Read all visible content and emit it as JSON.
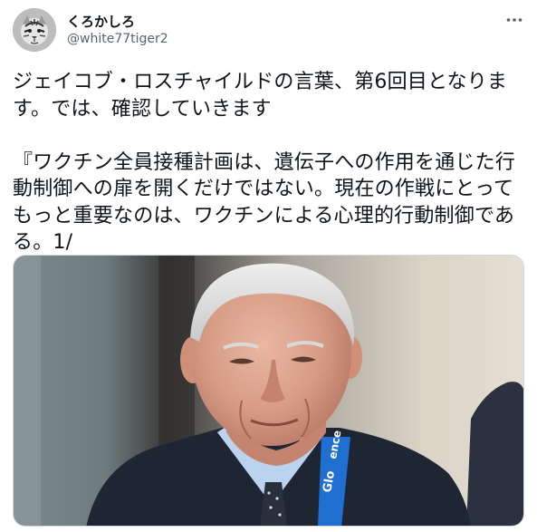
{
  "author": {
    "display_name": "くろかしろ",
    "handle": "@white77tiger2",
    "avatar_icon": "tiger-avatar-icon"
  },
  "menu": {
    "icon": "more-horizontal-icon"
  },
  "tweet": {
    "text": "ジェイコブ・ロスチャイルドの言葉、第6回目となります。では、確認していきます\n\n『ワクチン全員接種計画は、遺伝子への作用を通じた行動制御への扉を開くだけではない。現在の作戦にとってもっと重要なのは、ワクチンによる心理的行動制御である。1/"
  },
  "media": {
    "badge_text": "Glo",
    "badge_text2": "ence"
  },
  "colors": {
    "text_primary": "#0f1419",
    "text_secondary": "#536471",
    "lanyard_blue": "#1f6fd0"
  }
}
